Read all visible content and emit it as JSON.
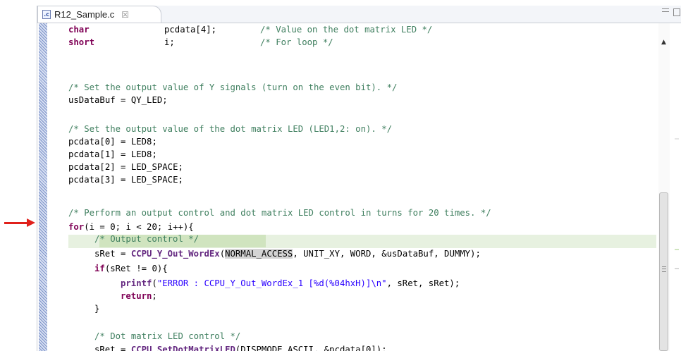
{
  "editor": {
    "tab": {
      "icon": "c-source-file-icon",
      "icon_glyph": ".c",
      "title": "R12_Sample.c",
      "close": "☒"
    },
    "colors": {
      "keyword": "#7f0055",
      "comment": "#3f7f5f",
      "string": "#2a00ff",
      "current_line": "#e7f1e0",
      "annotation_arrow": "#e0201b"
    }
  },
  "code": {
    "l1": {
      "type": "char",
      "decl": "pcdata[4];",
      "comment": "/* Value on the dot matrix LED */"
    },
    "l2": {
      "type": "short",
      "decl": "i;",
      "comment": "/* For loop */"
    },
    "l4": "/* Set the output value of Y signals (turn on the even bit). */",
    "l5": "usDataBuf = QY_LED;",
    "l7": "/* Set the output value of the dot matrix LED (LED1,2: on). */",
    "l8": "pcdata[0] = LED8;",
    "l9": "pcdata[1] = LED8;",
    "l10": "pcdata[2] = LED_SPACE;",
    "l11": "pcdata[3] = LED_SPACE;",
    "l13": "/* Perform an output control and dot matrix LED control in turns for 20 times. */",
    "l14": {
      "kw": "for",
      "rest": "(i = 0; i < 20; i++){"
    },
    "l15": "/* Output control */",
    "l16": {
      "pre": "sRet = ",
      "fn": "CCPU_Y_Out_WordEx",
      "open": "(",
      "arg1": "NORMAL_ACCESS",
      "rest": ", UNIT_XY, WORD, &usDataBuf, DUMMY);"
    },
    "l17": {
      "kw": "if",
      "rest": "(sRet != 0){"
    },
    "l18": {
      "fn": "printf",
      "open": "(",
      "str": "\"ERROR : CCPU_Y_Out_WordEx_1 [%d(%04hxH)]\\n\"",
      "rest": ", sRet, sRet);"
    },
    "l19": {
      "kw": "return",
      "rest": ";"
    },
    "l20": "}",
    "l22": "/* Dot matrix LED control */",
    "l23": {
      "pre": "sRet = ",
      "fn": "CCPU_SetDotMatrixLED",
      "rest": "(DISPMODE_ASCII, &pcdata[0]);"
    }
  }
}
